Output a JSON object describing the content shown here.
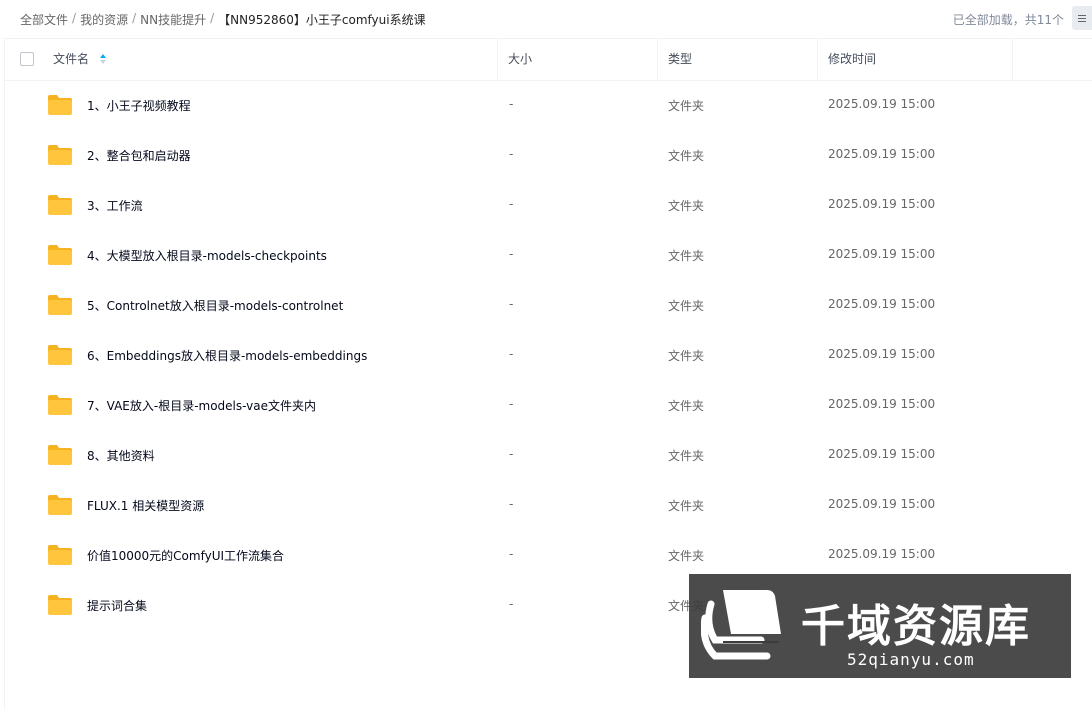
{
  "breadcrumb": {
    "items": [
      "全部文件",
      "我的资源",
      "NN技能提升"
    ],
    "current": "【NN952860】小王子comfyui系统课"
  },
  "status": "已全部加载，共11个",
  "table": {
    "headers": {
      "name": "文件名",
      "size": "大小",
      "type": "类型",
      "mtime": "修改时间"
    },
    "rows": [
      {
        "name": "1、小王子视频教程",
        "size": "-",
        "type": "文件夹",
        "mtime": "2025.09.19 15:00"
      },
      {
        "name": "2、整合包和启动器",
        "size": "-",
        "type": "文件夹",
        "mtime": "2025.09.19 15:00"
      },
      {
        "name": "3、工作流",
        "size": "-",
        "type": "文件夹",
        "mtime": "2025.09.19 15:00"
      },
      {
        "name": "4、大模型放入根目录-models-checkpoints",
        "size": "-",
        "type": "文件夹",
        "mtime": "2025.09.19 15:00"
      },
      {
        "name": "5、Controlnet放入根目录-models-controlnet",
        "size": "-",
        "type": "文件夹",
        "mtime": "2025.09.19 15:00"
      },
      {
        "name": "6、Embeddings放入根目录-models-embeddings",
        "size": "-",
        "type": "文件夹",
        "mtime": "2025.09.19 15:00"
      },
      {
        "name": "7、VAE放入-根目录-models-vae文件夹内",
        "size": "-",
        "type": "文件夹",
        "mtime": "2025.09.19 15:00"
      },
      {
        "name": "8、其他资料",
        "size": "-",
        "type": "文件夹",
        "mtime": "2025.09.19 15:00"
      },
      {
        "name": "FLUX.1 相关模型资源",
        "size": "-",
        "type": "文件夹",
        "mtime": "2025.09.19 15:00"
      },
      {
        "name": "价值10000元的ComfyUI工作流集合",
        "size": "-",
        "type": "文件夹",
        "mtime": "2025.09.19 15:00"
      },
      {
        "name": "提示词合集",
        "size": "-",
        "type": "文件夹",
        "mtime": ""
      }
    ]
  },
  "watermark": {
    "title": "千域资源库",
    "url": "52qianyu.com"
  },
  "colors": {
    "folder": "#ffc53d",
    "folder_dark": "#f5b321",
    "sort_active": "#06a7ff",
    "watermark_bg": "#3c3c3c"
  },
  "icons": {
    "folder": "folder-icon",
    "sort": "sort-icon",
    "list_toggle": "list-view-icon",
    "logo": "books-logo-icon"
  }
}
